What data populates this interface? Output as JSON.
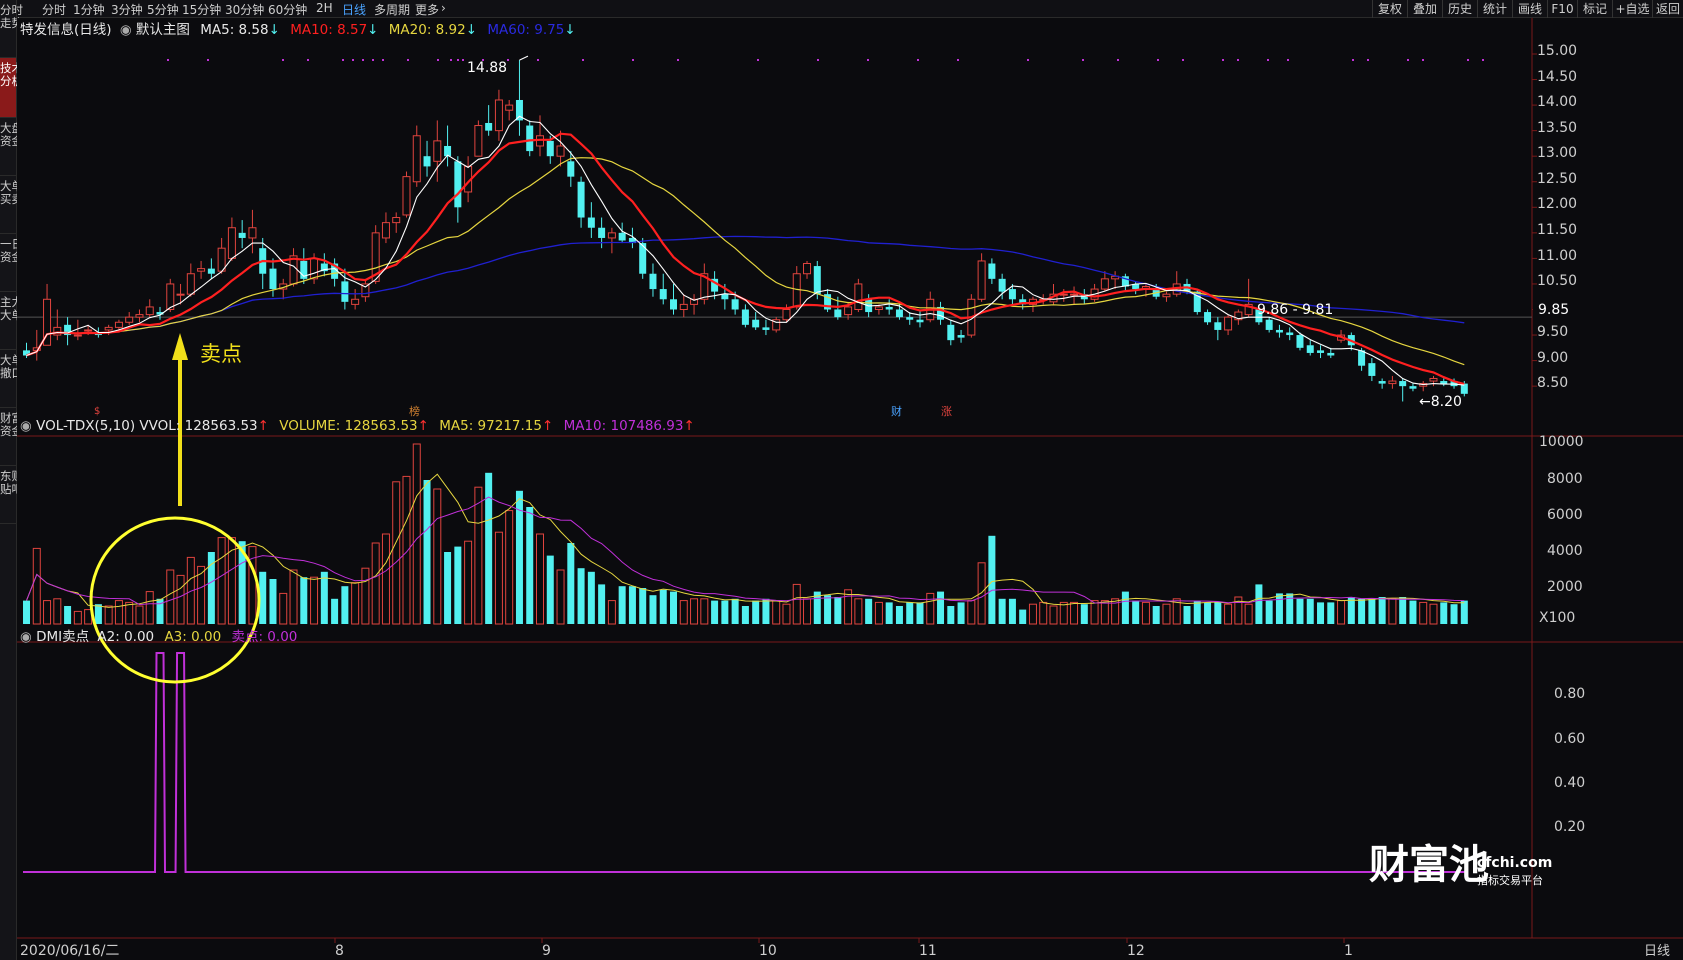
{
  "top_tabs": [
    "分时",
    "1分钟",
    "3分钟",
    "5分钟",
    "15分钟",
    "30分钟",
    "60分钟",
    "2H",
    "日线",
    "多周期",
    "更多"
  ],
  "active_tab": "日线",
  "right_buttons": [
    "复权",
    "叠加",
    "历史",
    "统计",
    "画线",
    "F10",
    "标记",
    "+自选",
    "返回"
  ],
  "side_tabs": [
    "分时\n走势",
    "技术\n分析",
    "大盘\n资金",
    "大单\n买卖",
    "一日\n资金",
    "主力\n大单",
    "大单\n撤口",
    "财富\n资金",
    "东财\n贴吧"
  ],
  "active_side_tab": "技术\n分析",
  "main_header": {
    "stock": "特发信息(日线)",
    "template": "默认主图",
    "ma5": "MA5: 8.58",
    "ma10": "MA10: 8.57",
    "ma20": "MA20: 8.92",
    "ma60": "MA60: 9.75",
    "arrow_down": "↓"
  },
  "vol_header": {
    "name": "VOL-TDX(5,10)",
    "vvol": "VVOL: 128563.53",
    "volume": "VOLUME: 128563.53",
    "ma5": "MA5: 97217.15",
    "ma10": "MA10: 107486.93",
    "arrow_up": "↑"
  },
  "dmi_header": {
    "name": "DMI卖点",
    "a2": "A2: 0.00",
    "a3": "A3: 0.00",
    "sell": "卖点: 0.00"
  },
  "annotations": {
    "high": "14.88",
    "low": "←8.20",
    "price_range": "9.86 - 9.81",
    "current_price": "9.85",
    "sell_label": "卖点",
    "event_markers": [
      "$",
      "榜",
      "财",
      "涨"
    ]
  },
  "price_axis_ticks": [
    "15.00",
    "14.50",
    "14.00",
    "13.50",
    "13.00",
    "12.50",
    "12.00",
    "11.50",
    "11.00",
    "10.50",
    "10.00",
    "9.50",
    "9.00",
    "8.50"
  ],
  "vol_axis_ticks": [
    "10000",
    "8000",
    "6000",
    "4000",
    "2000"
  ],
  "vol_unit": "X100",
  "dmi_axis_ticks": [
    "0.80",
    "0.60",
    "0.40",
    "0.20"
  ],
  "date_axis": {
    "start": "2020/06/16/二",
    "months": [
      "8",
      "9",
      "10",
      "11",
      "12",
      "1"
    ],
    "period": "日线"
  },
  "watermark": {
    "brand": "财富池",
    "site": "cfchi.com",
    "slogan": "指标交易平台"
  },
  "colors": {
    "up": "#e0443e",
    "down": "#52f0f0",
    "ma5": "#ffffff",
    "ma10": "#ff2020",
    "ma20": "#e6d640",
    "ma60": "#2020d0",
    "dmi": "#c030d8",
    "circle": "#ffff30"
  },
  "chart_data": {
    "type": "candlestick",
    "candles": [
      [
        9.2,
        9.35,
        9.05,
        9.1
      ],
      [
        9.2,
        9.6,
        9.0,
        9.25
      ],
      [
        9.3,
        10.5,
        9.3,
        10.2
      ],
      [
        9.5,
        10.0,
        9.4,
        9.65
      ],
      [
        9.7,
        9.85,
        9.3,
        9.5
      ],
      [
        9.5,
        9.8,
        9.4,
        9.5
      ],
      [
        9.6,
        9.7,
        9.5,
        9.6
      ],
      [
        9.55,
        9.65,
        9.45,
        9.5
      ],
      [
        9.6,
        9.7,
        9.5,
        9.65
      ],
      [
        9.65,
        9.8,
        9.55,
        9.75
      ],
      [
        9.75,
        9.95,
        9.7,
        9.85
      ],
      [
        9.85,
        10.0,
        9.75,
        9.9
      ],
      [
        9.9,
        10.2,
        9.85,
        10.05
      ],
      [
        9.95,
        10.05,
        9.8,
        9.9
      ],
      [
        10.0,
        10.6,
        9.95,
        10.5
      ],
      [
        10.3,
        10.5,
        10.1,
        10.3
      ],
      [
        10.3,
        10.9,
        10.25,
        10.7
      ],
      [
        10.75,
        10.95,
        10.6,
        10.8
      ],
      [
        10.8,
        11.0,
        10.6,
        10.7
      ],
      [
        10.75,
        11.4,
        10.7,
        11.2
      ],
      [
        11.0,
        11.8,
        10.95,
        11.6
      ],
      [
        11.5,
        11.75,
        11.2,
        11.4
      ],
      [
        11.4,
        11.95,
        11.1,
        11.6
      ],
      [
        11.2,
        11.4,
        10.4,
        10.7
      ],
      [
        10.8,
        11.0,
        10.25,
        10.4
      ],
      [
        10.4,
        10.6,
        10.2,
        10.5
      ],
      [
        10.5,
        11.2,
        10.45,
        11.05
      ],
      [
        10.95,
        11.2,
        10.5,
        10.6
      ],
      [
        10.6,
        11.1,
        10.5,
        11.0
      ],
      [
        10.9,
        11.1,
        10.65,
        10.75
      ],
      [
        10.9,
        11.0,
        10.45,
        10.6
      ],
      [
        10.55,
        10.8,
        10.0,
        10.15
      ],
      [
        10.1,
        10.4,
        10.0,
        10.2
      ],
      [
        10.25,
        10.6,
        10.15,
        10.5
      ],
      [
        10.55,
        11.65,
        10.5,
        11.5
      ],
      [
        11.4,
        11.9,
        11.3,
        11.7
      ],
      [
        11.7,
        11.9,
        11.5,
        11.8
      ],
      [
        11.85,
        12.7,
        11.8,
        12.6
      ],
      [
        12.5,
        13.6,
        12.4,
        13.4
      ],
      [
        13.0,
        13.3,
        12.6,
        12.8
      ],
      [
        12.9,
        13.7,
        12.5,
        13.3
      ],
      [
        13.2,
        13.6,
        12.8,
        13.0
      ],
      [
        12.9,
        13.0,
        11.7,
        12.0
      ],
      [
        12.3,
        13.0,
        12.1,
        12.8
      ],
      [
        13.0,
        13.7,
        13.0,
        13.6
      ],
      [
        13.65,
        14.0,
        13.4,
        13.5
      ],
      [
        13.5,
        14.3,
        13.3,
        14.1
      ],
      [
        13.9,
        14.1,
        13.7,
        14.0
      ],
      [
        14.1,
        14.88,
        13.4,
        13.7
      ],
      [
        13.6,
        13.7,
        13.0,
        13.1
      ],
      [
        13.2,
        13.8,
        13.0,
        13.4
      ],
      [
        13.3,
        13.4,
        12.85,
        13.0
      ],
      [
        13.0,
        13.5,
        12.8,
        13.2
      ],
      [
        12.9,
        13.1,
        12.4,
        12.6
      ],
      [
        12.5,
        12.6,
        11.6,
        11.8
      ],
      [
        11.8,
        12.1,
        11.4,
        11.6
      ],
      [
        11.6,
        11.8,
        11.2,
        11.4
      ],
      [
        11.4,
        11.6,
        11.1,
        11.5
      ],
      [
        11.5,
        11.7,
        11.3,
        11.35
      ],
      [
        11.4,
        11.6,
        11.2,
        11.3
      ],
      [
        11.3,
        11.4,
        10.6,
        10.7
      ],
      [
        10.7,
        10.9,
        10.25,
        10.4
      ],
      [
        10.4,
        10.7,
        10.1,
        10.2
      ],
      [
        10.2,
        10.5,
        9.9,
        10.0
      ],
      [
        10.0,
        10.3,
        9.85,
        10.1
      ],
      [
        10.1,
        10.3,
        9.9,
        10.2
      ],
      [
        10.2,
        10.9,
        10.1,
        10.7
      ],
      [
        10.6,
        10.75,
        10.2,
        10.35
      ],
      [
        10.3,
        10.5,
        10.0,
        10.2
      ],
      [
        10.2,
        10.35,
        9.9,
        10.0
      ],
      [
        10.0,
        10.1,
        9.65,
        9.7
      ],
      [
        9.8,
        9.95,
        9.6,
        9.65
      ],
      [
        9.65,
        9.8,
        9.5,
        9.6
      ],
      [
        9.6,
        9.85,
        9.55,
        9.8
      ],
      [
        9.8,
        10.1,
        9.75,
        10.0
      ],
      [
        10.05,
        10.85,
        10.0,
        10.7
      ],
      [
        10.7,
        10.95,
        10.6,
        10.9
      ],
      [
        10.85,
        10.95,
        10.2,
        10.3
      ],
      [
        10.3,
        10.4,
        9.95,
        10.0
      ],
      [
        10.0,
        10.25,
        9.8,
        9.85
      ],
      [
        9.9,
        10.15,
        9.8,
        10.05
      ],
      [
        10.0,
        10.6,
        9.95,
        10.5
      ],
      [
        10.2,
        10.3,
        9.85,
        9.95
      ],
      [
        10.0,
        10.1,
        9.9,
        10.05
      ],
      [
        10.05,
        10.2,
        9.9,
        10.0
      ],
      [
        10.0,
        10.1,
        9.8,
        9.85
      ],
      [
        9.85,
        9.95,
        9.7,
        9.8
      ],
      [
        9.8,
        10.0,
        9.65,
        9.75
      ],
      [
        9.8,
        10.35,
        9.75,
        10.2
      ],
      [
        10.05,
        10.15,
        9.7,
        9.8
      ],
      [
        9.7,
        9.8,
        9.3,
        9.4
      ],
      [
        9.5,
        9.6,
        9.35,
        9.45
      ],
      [
        9.5,
        10.3,
        9.45,
        10.2
      ],
      [
        10.2,
        11.1,
        10.15,
        10.95
      ],
      [
        10.9,
        11.0,
        10.5,
        10.6
      ],
      [
        10.6,
        10.7,
        10.2,
        10.35
      ],
      [
        10.4,
        10.5,
        10.1,
        10.2
      ],
      [
        10.2,
        10.3,
        10.0,
        10.1
      ],
      [
        10.1,
        10.25,
        9.95,
        10.2
      ],
      [
        10.2,
        10.3,
        10.1,
        10.2
      ],
      [
        10.15,
        10.5,
        10.1,
        10.3
      ],
      [
        10.3,
        10.4,
        10.15,
        10.3
      ],
      [
        10.3,
        10.45,
        10.1,
        10.3
      ],
      [
        10.3,
        10.4,
        10.1,
        10.2
      ],
      [
        10.2,
        10.5,
        10.15,
        10.4
      ],
      [
        10.4,
        10.75,
        10.35,
        10.6
      ],
      [
        10.6,
        10.75,
        10.4,
        10.65
      ],
      [
        10.65,
        10.7,
        10.35,
        10.45
      ],
      [
        10.5,
        10.55,
        10.3,
        10.4
      ],
      [
        10.4,
        10.5,
        10.25,
        10.45
      ],
      [
        10.4,
        10.5,
        10.2,
        10.25
      ],
      [
        10.25,
        10.35,
        10.15,
        10.3
      ],
      [
        10.3,
        10.75,
        10.25,
        10.5
      ],
      [
        10.5,
        10.6,
        10.3,
        10.35
      ],
      [
        10.35,
        10.4,
        9.9,
        9.95
      ],
      [
        9.95,
        10.0,
        9.7,
        9.75
      ],
      [
        9.75,
        9.85,
        9.4,
        9.6
      ],
      [
        9.6,
        9.9,
        9.5,
        9.85
      ],
      [
        9.8,
        10.0,
        9.7,
        9.95
      ],
      [
        9.9,
        10.6,
        9.85,
        10.1
      ],
      [
        10.0,
        10.05,
        9.7,
        9.75
      ],
      [
        9.8,
        9.85,
        9.55,
        9.6
      ],
      [
        9.6,
        9.7,
        9.45,
        9.55
      ],
      [
        9.55,
        9.65,
        9.4,
        9.5
      ],
      [
        9.5,
        9.55,
        9.2,
        9.25
      ],
      [
        9.3,
        9.4,
        9.1,
        9.15
      ],
      [
        9.2,
        9.3,
        9.05,
        9.15
      ],
      [
        9.15,
        9.25,
        9.05,
        9.1
      ],
      [
        9.4,
        9.6,
        9.35,
        9.5
      ],
      [
        9.5,
        9.55,
        9.2,
        9.3
      ],
      [
        9.2,
        9.25,
        8.8,
        8.9
      ],
      [
        8.95,
        9.05,
        8.6,
        8.7
      ],
      [
        8.6,
        8.65,
        8.45,
        8.55
      ],
      [
        8.55,
        8.7,
        8.45,
        8.6
      ],
      [
        8.6,
        8.65,
        8.2,
        8.5
      ],
      [
        8.5,
        8.55,
        8.4,
        8.45
      ],
      [
        8.5,
        8.6,
        8.4,
        8.55
      ],
      [
        8.6,
        8.7,
        8.5,
        8.65
      ],
      [
        8.6,
        8.65,
        8.5,
        8.55
      ],
      [
        8.6,
        8.65,
        8.45,
        8.5
      ],
      [
        8.55,
        8.6,
        8.3,
        8.35
      ]
    ],
    "volume_hundreds": [
      1300,
      4200,
      1300,
      1400,
      1000,
      700,
      800,
      1100,
      1000,
      1300,
      1200,
      1000,
      1800,
      1400,
      3000,
      2700,
      3700,
      3200,
      4000,
      4800,
      4800,
      4600,
      4300,
      2900,
      2500,
      1700,
      3000,
      2600,
      2600,
      2900,
      1400,
      2100,
      2300,
      3100,
      4500,
      5000,
      7900,
      8200,
      10000,
      8000,
      7500,
      4000,
      4300,
      4600,
      7600,
      8400,
      5100,
      6300,
      7400,
      6500,
      5000,
      3800,
      3000,
      4500,
      3100,
      2900,
      2200,
      1300,
      2100,
      2100,
      2000,
      1600,
      1900,
      1800,
      1300,
      1400,
      1400,
      1300,
      1300,
      1400,
      1000,
      1300,
      1400,
      1300,
      1100,
      2200,
      1400,
      1800,
      1600,
      1500,
      1900,
      1400,
      1400,
      1200,
      1200,
      1000,
      1200,
      1200,
      1700,
      1800,
      1000,
      1200,
      1300,
      3400,
      4900,
      1400,
      1400,
      800,
      1100,
      1200,
      1000,
      1200,
      1200,
      1100,
      1300,
      1300,
      1400,
      1800,
      1300,
      1200,
      1000,
      1100,
      1400,
      1000,
      1300,
      1200,
      1200,
      1100,
      1500,
      1100,
      2200,
      1300,
      1700,
      1700,
      1400,
      1400,
      1200,
      1200,
      1300,
      1500,
      1400,
      1400,
      1500,
      1400,
      1500,
      1300,
      1200,
      1100,
      1200,
      1100,
      1300
    ]
  }
}
